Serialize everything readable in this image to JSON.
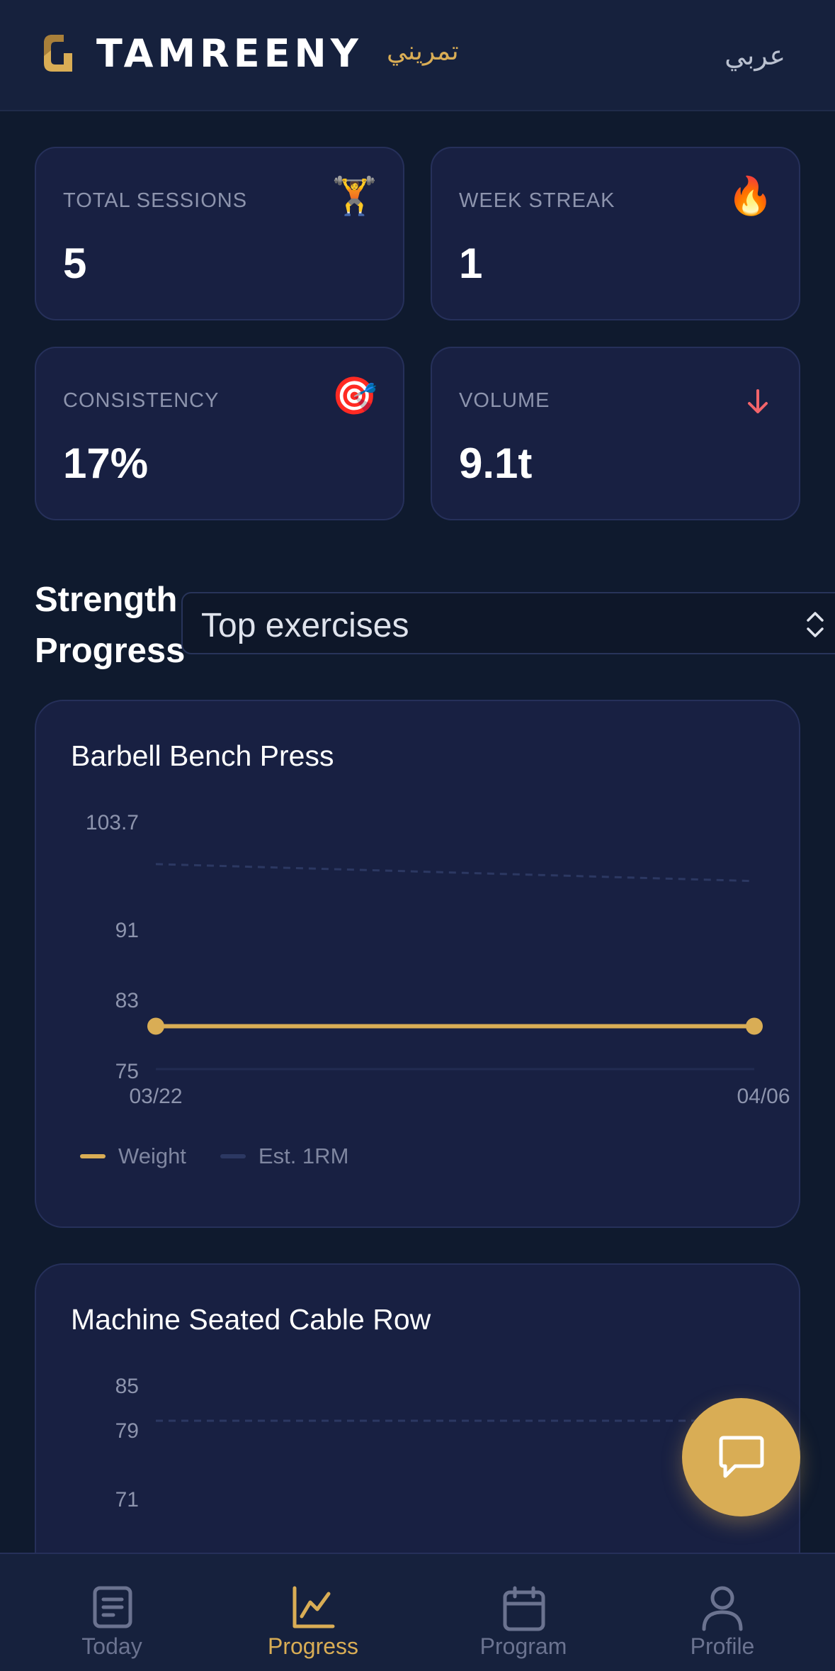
{
  "header": {
    "brand": "TAMREENY",
    "brand_arabic": "تمريني",
    "language_toggle": "عربي",
    "logo_icon": "tamreeny-logo-icon"
  },
  "stats": [
    {
      "label": "TOTAL SESSIONS",
      "value": "5",
      "icon": "weightlifter-emoji",
      "glyph": "🏋️"
    },
    {
      "label": "WEEK STREAK",
      "value": "1",
      "icon": "fire-emoji",
      "glyph": "🔥"
    },
    {
      "label": "CONSISTENCY",
      "value": "17%",
      "icon": "target-emoji",
      "glyph": "🎯"
    },
    {
      "label": "VOLUME",
      "value": "9.1t",
      "icon": "arrow-down-icon"
    }
  ],
  "strength": {
    "title_line1": "Strength",
    "title_line2": "Progress",
    "selector_value": "Top exercises"
  },
  "charts": [
    {
      "title": "Barbell Bench Press",
      "legend": [
        "Weight",
        "Est. 1RM"
      ]
    },
    {
      "title": "Machine Seated Cable Row"
    }
  ],
  "chart_data": [
    {
      "type": "line",
      "title": "Barbell Bench Press",
      "x": [
        "03/22",
        "04/06"
      ],
      "y_ticks": [
        "103.7",
        "91",
        "83",
        "75"
      ],
      "ylim": [
        75,
        103.7
      ],
      "series": [
        {
          "name": "Weight",
          "values": [
            80,
            80
          ],
          "color": "#d9ad55"
        },
        {
          "name": "Est. 1RM",
          "values": [
            98.7,
            96.7
          ],
          "color": "#2c3862"
        }
      ],
      "legend_position": "bottom-left",
      "grid": false
    },
    {
      "type": "line",
      "title": "Machine Seated Cable Row",
      "y_ticks": [
        "85",
        "79",
        "71"
      ],
      "series": [
        {
          "name": "Est. 1RM",
          "values": [
            79,
            79
          ],
          "color": "#2c3862"
        }
      ]
    }
  ],
  "fab": {
    "icon": "chat-bubble-icon"
  },
  "nav": [
    {
      "label": "Today",
      "icon": "document-icon",
      "active": false
    },
    {
      "label": "Progress",
      "icon": "chart-line-icon",
      "active": true
    },
    {
      "label": "Program",
      "icon": "calendar-icon",
      "active": false
    },
    {
      "label": "Profile",
      "icon": "user-icon",
      "active": false
    }
  ],
  "colors": {
    "accent": "#d9ad55",
    "background": "#0f1a2e",
    "card": "#182042",
    "header": "#16213d",
    "down_arrow": "#f2646a"
  }
}
